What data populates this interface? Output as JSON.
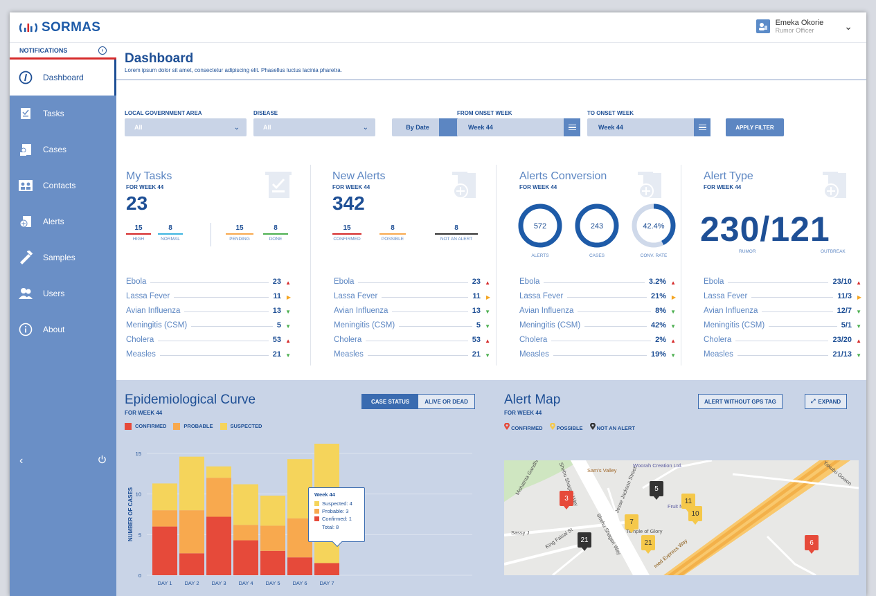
{
  "app": {
    "logo_text": "SORMAS"
  },
  "user": {
    "name": "Emeka Okorie",
    "role": "Rumor Officer"
  },
  "sidebar": {
    "notifications_label": "NOTIFICATIONS",
    "items": [
      {
        "label": "Dashboard",
        "icon": "dashboard-icon",
        "active": true
      },
      {
        "label": "Tasks",
        "icon": "tasks-icon"
      },
      {
        "label": "Cases",
        "icon": "cases-icon"
      },
      {
        "label": "Contacts",
        "icon": "contacts-icon"
      },
      {
        "label": "Alerts",
        "icon": "alerts-icon"
      },
      {
        "label": "Samples",
        "icon": "samples-icon"
      },
      {
        "label": "Users",
        "icon": "users-icon"
      },
      {
        "label": "About",
        "icon": "about-icon"
      }
    ]
  },
  "page": {
    "title": "Dashboard",
    "subtitle": "Lorem ipsum dolor sit amet, consectetur adipiscing elit. Phasellus luctus lacinia pharetra."
  },
  "filters": {
    "lga_label": "LOCAL GOVERNMENT AREA",
    "lga_value": "All",
    "disease_label": "DISEASE",
    "disease_value": "All",
    "by_date": "By Date",
    "from_label": "FROM ONSET WEEK",
    "from_value": "Week 44",
    "to_label": "TO ONSET WEEK",
    "to_value": "Week 44",
    "apply": "APPLY FILTER"
  },
  "diseases": [
    "Ebola",
    "Lassa Fever",
    "Avian Influenza",
    "Meningitis (CSM)",
    "Cholera",
    "Measles"
  ],
  "trend_icons": [
    "arrow-up",
    "arrow-right",
    "arrow-down",
    "arrow-down",
    "arrow-up",
    "arrow-down"
  ],
  "colors": {
    "primary": "#1e4f95",
    "accent": "#5c86c2",
    "confirmed": "#e64a3a",
    "probable": "#f8a94e",
    "suspected": "#f5d45b",
    "up": "#d62a2a",
    "flat": "#f5a623",
    "down": "#4caf50"
  },
  "cards": {
    "tasks": {
      "title": "My Tasks",
      "week": "FOR WEEK 44",
      "total": "23",
      "subs": [
        {
          "value": "15",
          "label": "HIGH",
          "color": "#d62a2a"
        },
        {
          "value": "8",
          "label": "NORMAL",
          "color": "#3fb5e0"
        },
        {
          "value": "15",
          "label": "PENDING",
          "color": "#f8a94e"
        },
        {
          "value": "8",
          "label": "DONE",
          "color": "#4caf50"
        }
      ],
      "values": [
        "23",
        "11",
        "13",
        "5",
        "53",
        "21"
      ]
    },
    "alerts": {
      "title": "New Alerts",
      "week": "FOR WEEK 44",
      "total": "342",
      "subs": [
        {
          "value": "15",
          "label": "CONFIRMED",
          "color": "#d62a2a"
        },
        {
          "value": "8",
          "label": "POSSIBLE",
          "color": "#f8a94e"
        },
        {
          "value": "8",
          "label": "NOT AN ALERT",
          "color": "#333333"
        }
      ],
      "values": [
        "23",
        "11",
        "13",
        "5",
        "53",
        "21"
      ]
    },
    "conversion": {
      "title": "Alerts Conversion",
      "week": "FOR WEEK 44",
      "rings": [
        {
          "value": "572",
          "label": "ALERTS",
          "fraction": 1.0
        },
        {
          "value": "243",
          "label": "CASES",
          "fraction": 1.0
        },
        {
          "value": "42.4%",
          "label": "CONV. RATE",
          "fraction": 0.424
        }
      ],
      "values": [
        "3.2%",
        "21%",
        "8%",
        "42%",
        "2%",
        "19%"
      ]
    },
    "type": {
      "title": "Alert Type",
      "week": "FOR WEEK 44",
      "ratio": "230/121",
      "left_label": "RUMOR",
      "right_label": "OUTBREAK",
      "values": [
        "23/10",
        "11/3",
        "12/7",
        "5/1",
        "23/20",
        "21/13"
      ]
    }
  },
  "epi": {
    "title": "Epidemiological Curve",
    "week": "FOR WEEK 44",
    "toggle_on": "CASE STATUS",
    "toggle_off": "ALIVE OR DEAD",
    "legend": [
      "CONFIRMED",
      "PROBABLE",
      "SUSPECTED"
    ],
    "tooltip": {
      "title": "Week 44",
      "suspected": "Suspected: 4",
      "probable": "Probable: 3",
      "confirmed": "Confirmed: 1",
      "total": "Total: 8"
    }
  },
  "chart_data": {
    "type": "bar",
    "stacked": true,
    "ylabel": "NUMBER OF CASES",
    "ylim": [
      0,
      15
    ],
    "yticks": [
      0,
      5,
      10,
      15
    ],
    "categories": [
      "DAY 1",
      "DAY 2",
      "DAY 3",
      "DAY 4",
      "DAY 5",
      "DAY 6",
      "DAY 7"
    ],
    "series": [
      {
        "name": "CONFIRMED",
        "color": "#e64a3a",
        "values": [
          6,
          2.7,
          7.2,
          4.3,
          3,
          2.2,
          1.5
        ]
      },
      {
        "name": "PROBABLE",
        "color": "#f8a94e",
        "values": [
          2,
          5.3,
          4.8,
          1.9,
          3.1,
          4.8,
          0
        ]
      },
      {
        "name": "SUSPECTED",
        "color": "#f5d45b",
        "values": [
          3.3,
          6.6,
          1.4,
          5,
          3.7,
          7.3,
          15
        ]
      }
    ]
  },
  "map": {
    "title": "Alert Map",
    "week": "FOR WEEK 44",
    "legend": [
      "CONFIRMED",
      "POSSIBLE",
      "NOT AN ALERT"
    ],
    "btn_no_gps": "ALERT WITHOUT GPS TAG",
    "btn_expand": "EXPAND",
    "labels": {
      "woorah": "Woorah Creation Ltd.",
      "sams": "Sam's Valley",
      "fruit": "Fruit Market",
      "sassy": "Sassy J",
      "temple": "Temple of Glory",
      "shehu1": "Shehu Shagari Way",
      "shehu2": "Shehu Shagari Way",
      "jesse": "Jesse Jackson Street",
      "kingfaisal": "King Faisal St",
      "yakubu": "Yakubu Gowon",
      "mahatma": "Mahatma Gandhi",
      "express": "med Express Way"
    },
    "markers": [
      {
        "n": "3",
        "kind": "confirmed"
      },
      {
        "n": "5",
        "kind": "not"
      },
      {
        "n": "11",
        "kind": "possible"
      },
      {
        "n": "10",
        "kind": "possible"
      },
      {
        "n": "7",
        "kind": "possible"
      },
      {
        "n": "21",
        "kind": "not"
      },
      {
        "n": "21",
        "kind": "possible"
      },
      {
        "n": "6",
        "kind": "confirmed"
      }
    ]
  }
}
